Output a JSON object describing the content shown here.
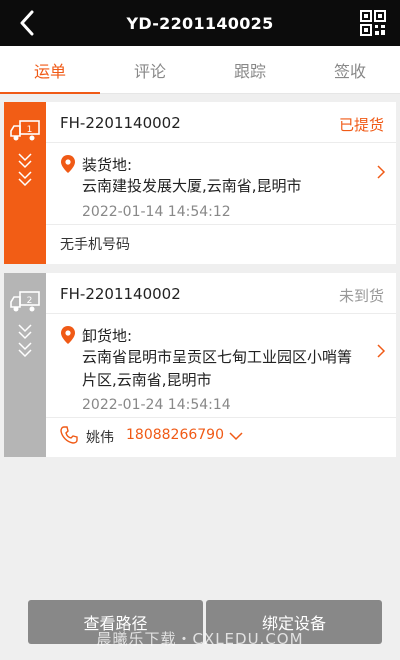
{
  "header": {
    "title": "YD-2201140025"
  },
  "tabs": [
    {
      "label": "运单",
      "active": true
    },
    {
      "label": "评论",
      "active": false
    },
    {
      "label": "跟踪",
      "active": false
    },
    {
      "label": "签收",
      "active": false
    }
  ],
  "cards": [
    {
      "index": "1",
      "code": "FH-2201140002",
      "status": "已提货",
      "location_label": "装货地:",
      "address": "云南建投发展大厦,云南省,昆明市",
      "time": "2022-01-14 14:54:12",
      "note": "无手机号码"
    },
    {
      "index": "2",
      "code": "FH-2201140002",
      "status": "未到货",
      "location_label": "卸货地:",
      "address": "云南省昆明市呈贡区七甸工业园区小哨箐片区,云南省,昆明市",
      "time": "2022-01-24 14:54:14",
      "contact_name": "姚伟",
      "contact_phone": "18088266790"
    }
  ],
  "buttons": {
    "route": "查看路径",
    "bind_device": "绑定设备"
  },
  "watermark": "晨曦乐下载・CXLEDU.COM",
  "colors": {
    "accent": "#f05a16",
    "header_bg": "#0c0c0c",
    "inactive_strip": "#b5b5b5"
  }
}
